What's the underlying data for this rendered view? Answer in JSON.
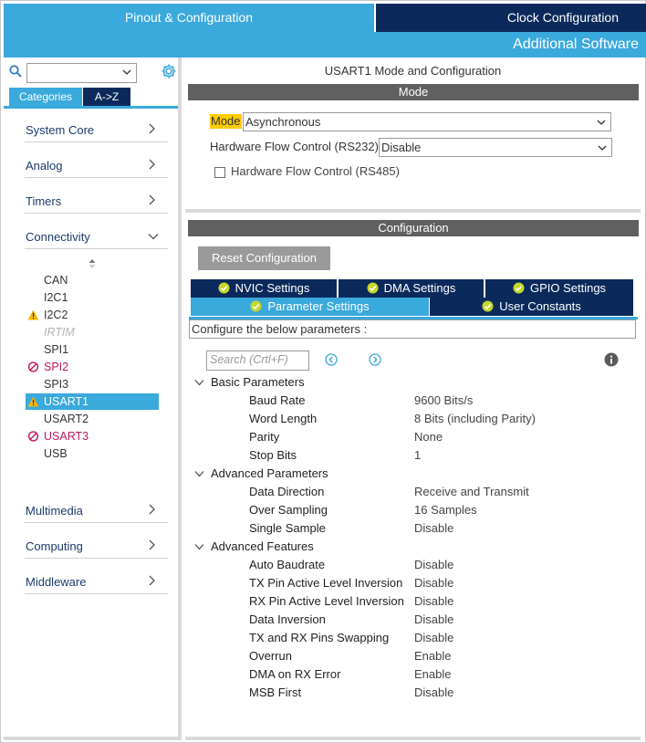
{
  "top_tabs": {
    "pinout": "Pinout & Configuration",
    "clock": "Clock Configuration",
    "additional": "Additional Software"
  },
  "left": {
    "search_value": "",
    "tabs": {
      "categories": "Categories",
      "az": "A->Z"
    },
    "categories": [
      {
        "label": "System Core",
        "icon": "chevron-right-icon"
      },
      {
        "label": "Analog",
        "icon": "chevron-right-icon"
      },
      {
        "label": "Timers",
        "icon": "chevron-right-icon"
      },
      {
        "label": "Connectivity",
        "icon": "chevron-down-icon"
      }
    ],
    "connectivity_items": [
      {
        "label": "CAN",
        "status": "none"
      },
      {
        "label": "I2C1",
        "status": "none"
      },
      {
        "label": "I2C2",
        "status": "warning"
      },
      {
        "label": "IRTIM",
        "status": "disabled"
      },
      {
        "label": "SPI1",
        "status": "none"
      },
      {
        "label": "SPI2",
        "status": "error"
      },
      {
        "label": "SPI3",
        "status": "none"
      },
      {
        "label": "USART1",
        "status": "warning-selected"
      },
      {
        "label": "USART2",
        "status": "none"
      },
      {
        "label": "USART3",
        "status": "error"
      },
      {
        "label": "USB",
        "status": "none"
      }
    ],
    "bottom_categories": [
      {
        "label": "Multimedia",
        "icon": "chevron-right-icon"
      },
      {
        "label": "Computing",
        "icon": "chevron-right-icon"
      },
      {
        "label": "Middleware",
        "icon": "chevron-right-icon"
      }
    ]
  },
  "mode_panel": {
    "title": "USART1 Mode and Configuration",
    "section": "Mode",
    "mode_label": "Mode",
    "mode_value": "Asynchronous",
    "hfc232_label": "Hardware Flow Control (RS232)",
    "hfc232_value": "Disable",
    "hfc485_label": "Hardware Flow Control (RS485)",
    "hfc485_checked": false
  },
  "config_panel": {
    "section": "Configuration",
    "reset_label": "Reset Configuration",
    "tabs_row1": [
      "NVIC Settings",
      "DMA Settings",
      "GPIO Settings"
    ],
    "tabs_row2": [
      "Parameter Settings",
      "User Constants"
    ],
    "active_tab": "Parameter Settings",
    "configure_text": "Configure the below parameters :",
    "search_placeholder": "Search (Crtl+F)",
    "groups": [
      {
        "name": "Basic Parameters",
        "params": [
          {
            "name": "Baud Rate",
            "value": "9600 Bits/s"
          },
          {
            "name": "Word Length",
            "value": "8 Bits (including Parity)"
          },
          {
            "name": "Parity",
            "value": "None"
          },
          {
            "name": "Stop Bits",
            "value": "1"
          }
        ]
      },
      {
        "name": "Advanced Parameters",
        "params": [
          {
            "name": "Data Direction",
            "value": "Receive and Transmit"
          },
          {
            "name": "Over Sampling",
            "value": "16 Samples"
          },
          {
            "name": "Single Sample",
            "value": "Disable"
          }
        ]
      },
      {
        "name": "Advanced Features",
        "params": [
          {
            "name": "Auto Baudrate",
            "value": "Disable"
          },
          {
            "name": "TX Pin Active Level Inversion",
            "value": "Disable"
          },
          {
            "name": "RX Pin Active Level Inversion",
            "value": "Disable"
          },
          {
            "name": "Data Inversion",
            "value": "Disable"
          },
          {
            "name": "TX and RX Pins Swapping",
            "value": "Disable"
          },
          {
            "name": "Overrun",
            "value": "Enable"
          },
          {
            "name": "DMA on RX Error",
            "value": "Enable"
          },
          {
            "name": "MSB First",
            "value": "Disable"
          }
        ]
      }
    ]
  },
  "colors": {
    "accent": "#3aa9dc",
    "dark_navy": "#0b2a5b",
    "section_bar": "#606060",
    "warning": "#f5b800",
    "error": "#c2185b",
    "highlight": "#ffcc00",
    "check_green": "#c6d72c"
  }
}
